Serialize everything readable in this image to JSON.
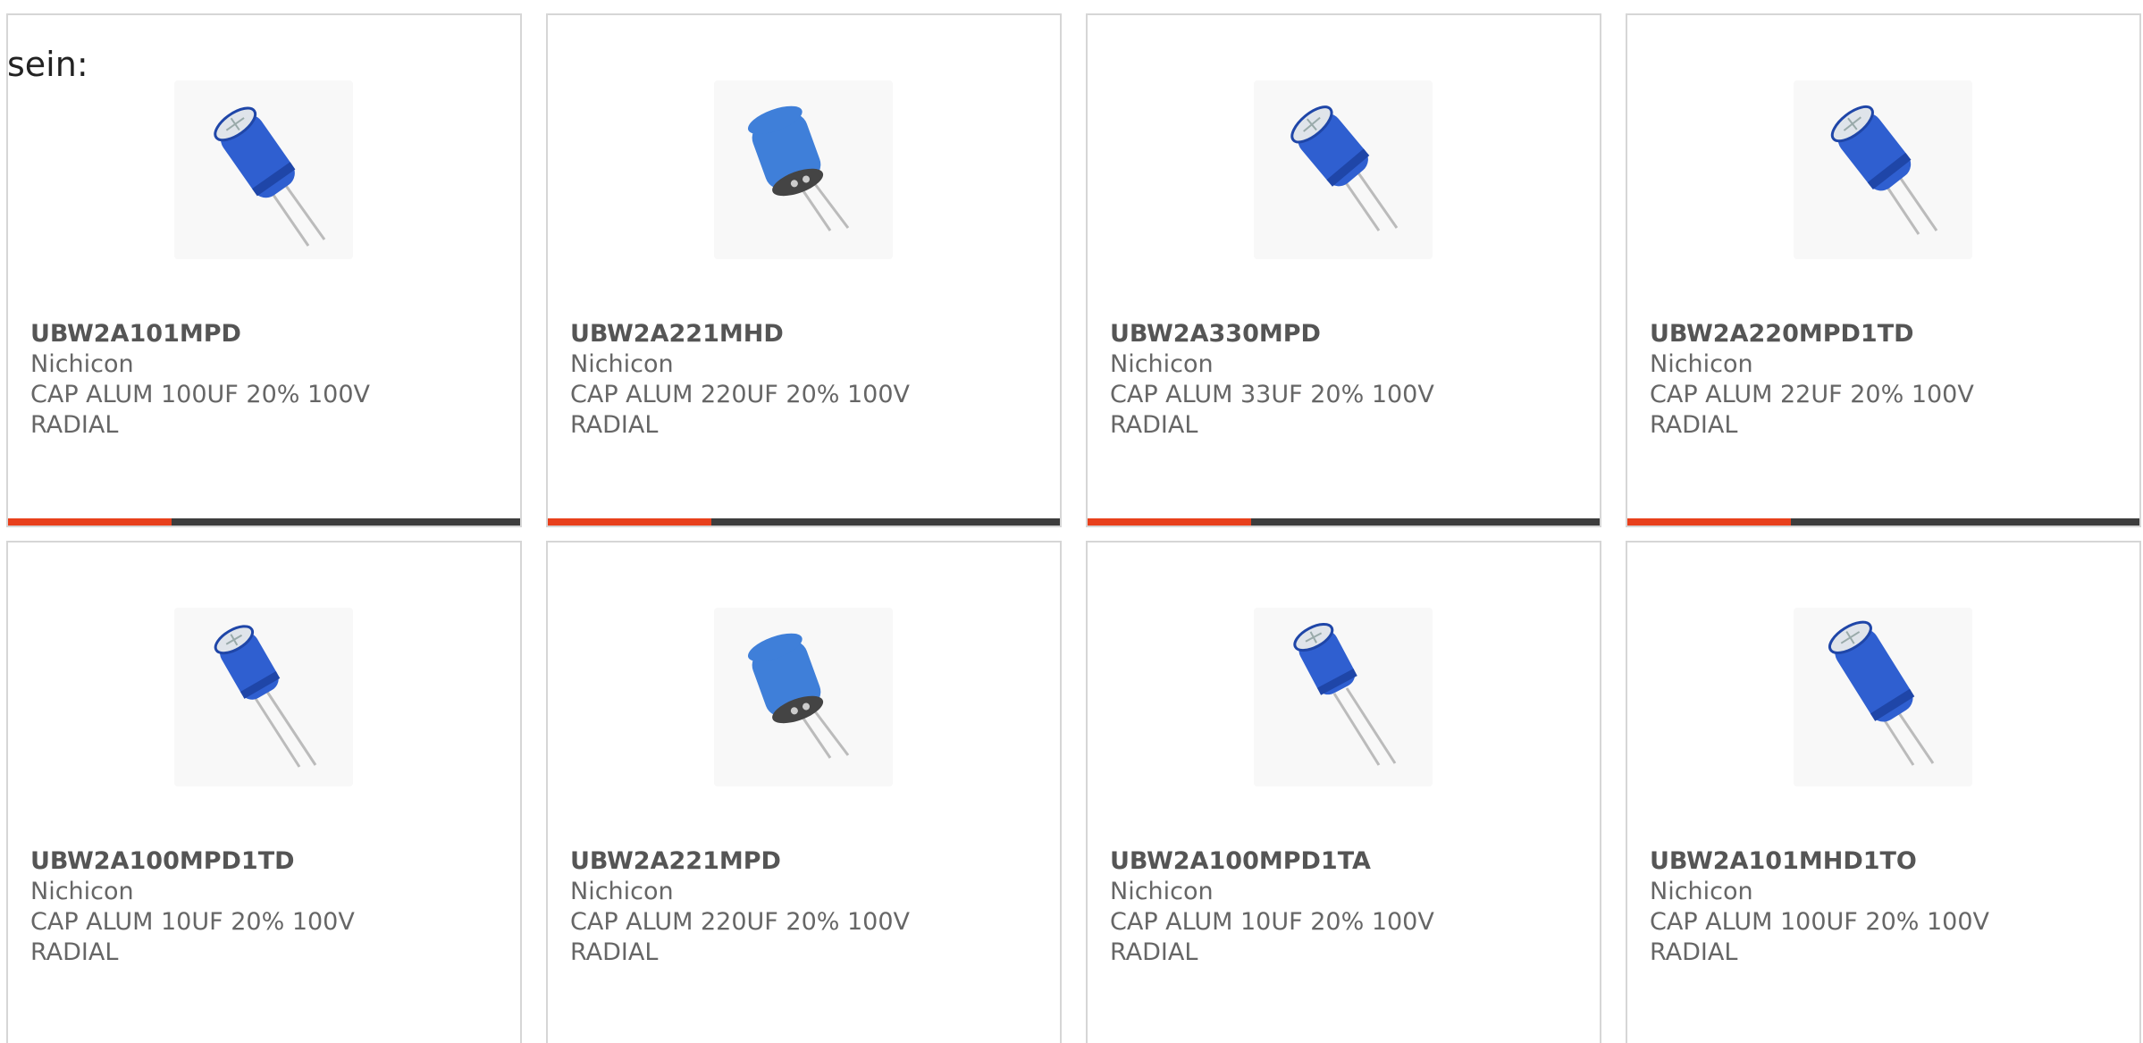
{
  "page": {
    "intro_text": "sein:"
  },
  "colors": {
    "accent_bar": "#e8401c",
    "bar_base": "#3d3d3d",
    "capacitor_blue": "#2f5fd0"
  },
  "products": [
    {
      "part": "UBW2A101MPD",
      "manufacturer": "Nichicon",
      "desc1": "CAP ALUM 100UF 20% 100V",
      "desc2": "RADIAL",
      "image_icon": "radial-capacitor-icon"
    },
    {
      "part": "UBW2A221MHD",
      "manufacturer": "Nichicon",
      "desc1": "CAP ALUM 220UF 20% 100V",
      "desc2": "RADIAL",
      "image_icon": "radial-capacitor-icon"
    },
    {
      "part": "UBW2A330MPD",
      "manufacturer": "Nichicon",
      "desc1": "CAP ALUM 33UF 20% 100V",
      "desc2": "RADIAL",
      "image_icon": "radial-capacitor-icon"
    },
    {
      "part": "UBW2A220MPD1TD",
      "manufacturer": "Nichicon",
      "desc1": "CAP ALUM 22UF 20% 100V",
      "desc2": "RADIAL",
      "image_icon": "radial-capacitor-icon"
    },
    {
      "part": "UBW2A100MPD1TD",
      "manufacturer": "Nichicon",
      "desc1": "CAP ALUM 10UF 20% 100V",
      "desc2": "RADIAL",
      "image_icon": "radial-capacitor-icon"
    },
    {
      "part": "UBW2A221MPD",
      "manufacturer": "Nichicon",
      "desc1": "CAP ALUM 220UF 20% 100V",
      "desc2": "RADIAL",
      "image_icon": "radial-capacitor-icon"
    },
    {
      "part": "UBW2A100MPD1TA",
      "manufacturer": "Nichicon",
      "desc1": "CAP ALUM 10UF 20% 100V",
      "desc2": "RADIAL",
      "image_icon": "radial-capacitor-icon"
    },
    {
      "part": "UBW2A101MHD1TO",
      "manufacturer": "Nichicon",
      "desc1": "CAP ALUM 100UF 20% 100V",
      "desc2": "RADIAL",
      "image_icon": "radial-capacitor-icon"
    }
  ]
}
